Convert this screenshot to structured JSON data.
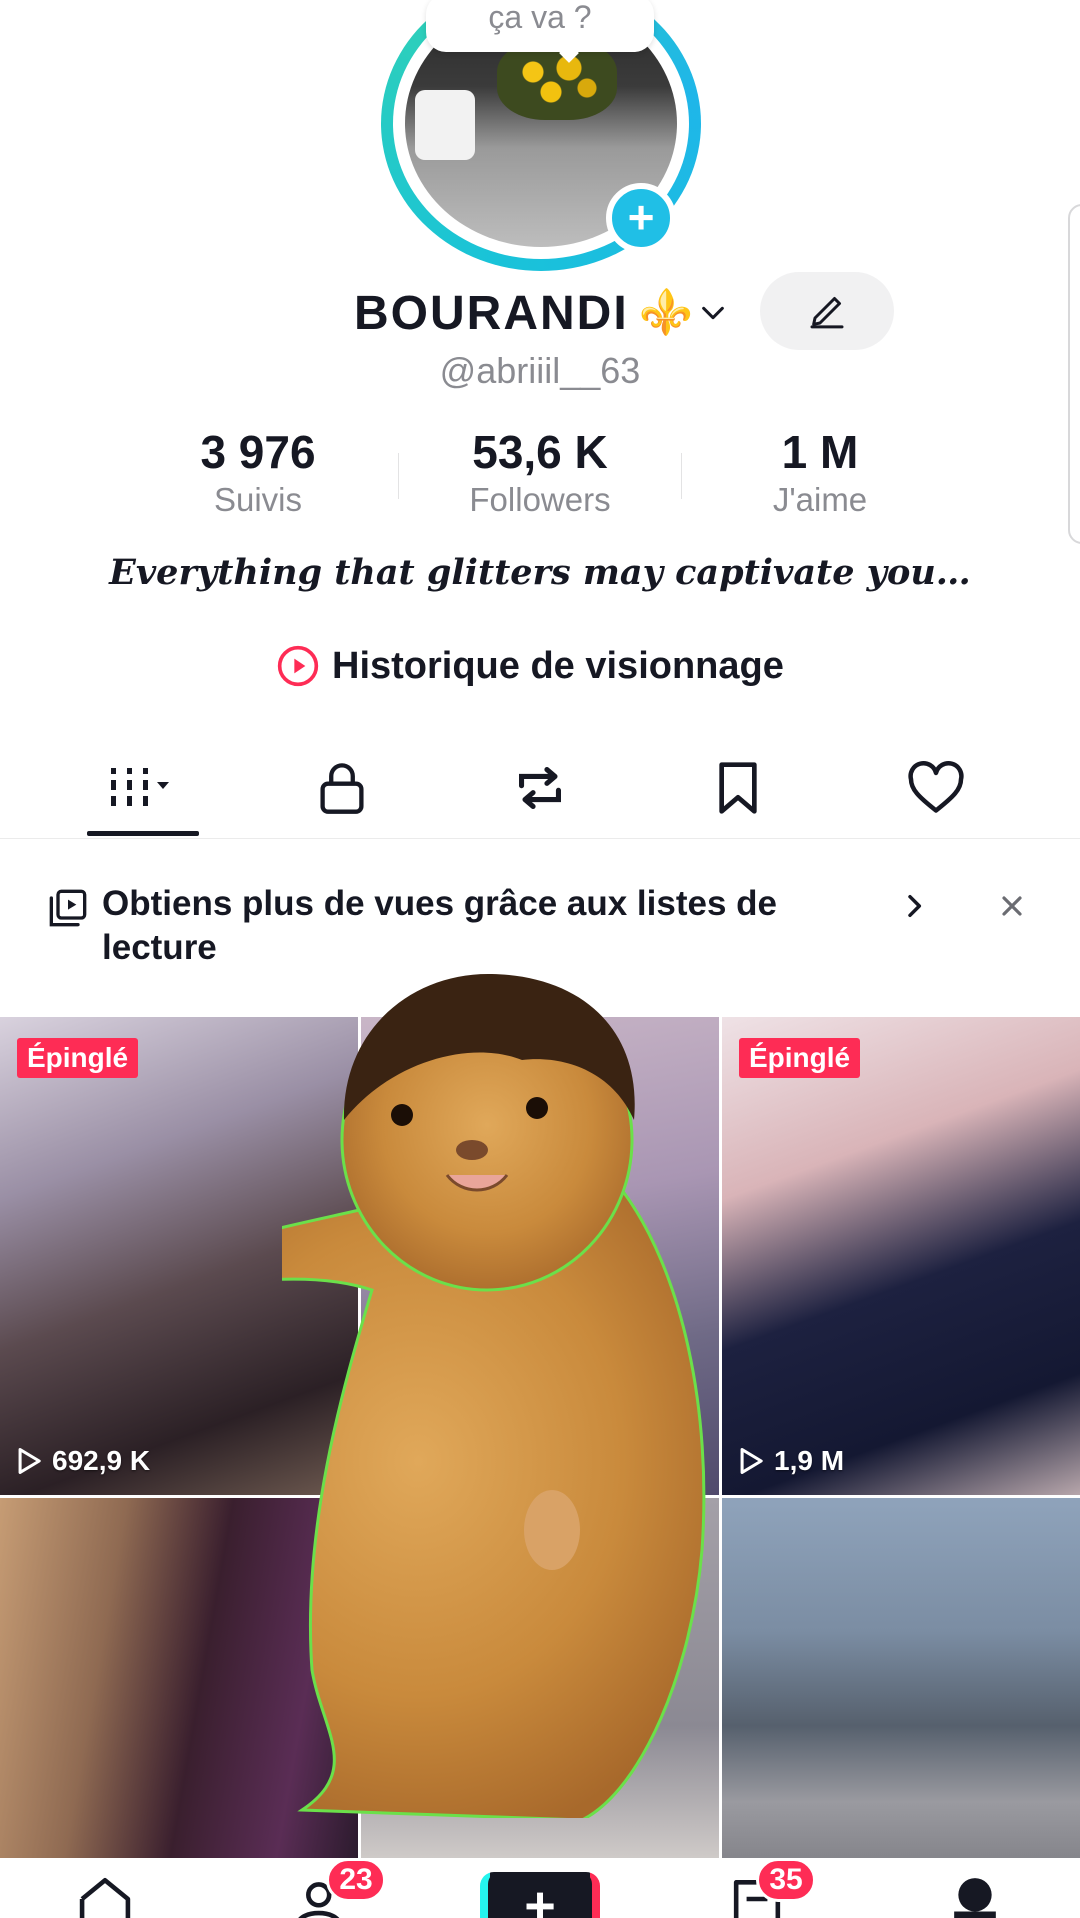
{
  "profile": {
    "bubble_text": "ça va ?",
    "display_name": "BOURANDI",
    "name_emoji": "⚜️",
    "username": "@abriiil__63",
    "bio": "Everything that glitters may captivate you…"
  },
  "stats": [
    {
      "value": "3 976",
      "label": "Suivis"
    },
    {
      "value": "53,6 K",
      "label": "Followers"
    },
    {
      "value": "1 M",
      "label": "J'aime"
    }
  ],
  "history": {
    "label": "Historique de visionnage"
  },
  "tabs": [
    {
      "name": "videos",
      "icon": "grid-icon",
      "active": true
    },
    {
      "name": "private",
      "icon": "lock-icon",
      "active": false
    },
    {
      "name": "reposts",
      "icon": "repost-icon",
      "active": false
    },
    {
      "name": "favorites",
      "icon": "bookmark-icon",
      "active": false
    },
    {
      "name": "liked",
      "icon": "heart-icon",
      "active": false
    }
  ],
  "banner": {
    "text": "Obtiens plus de vues grâce aux listes de lecture"
  },
  "videos": [
    {
      "pinned_label": "Épinglé",
      "views": "692,9 K"
    },
    {
      "pinned_label": "",
      "views": ""
    },
    {
      "pinned_label": "Épinglé",
      "views": "1,9 M"
    },
    {
      "pinned_label": "",
      "views": ""
    },
    {
      "pinned_label": "",
      "views": ""
    },
    {
      "pinned_label": "",
      "views": ""
    }
  ],
  "bottom_nav": {
    "friends_badge": "23",
    "inbox_badge": "35",
    "create_symbol": "+"
  },
  "colors": {
    "accent": "#fe2c55",
    "avatar_ring": "#19c3d8",
    "text_primary": "#161823",
    "text_secondary": "#8a8b91"
  }
}
